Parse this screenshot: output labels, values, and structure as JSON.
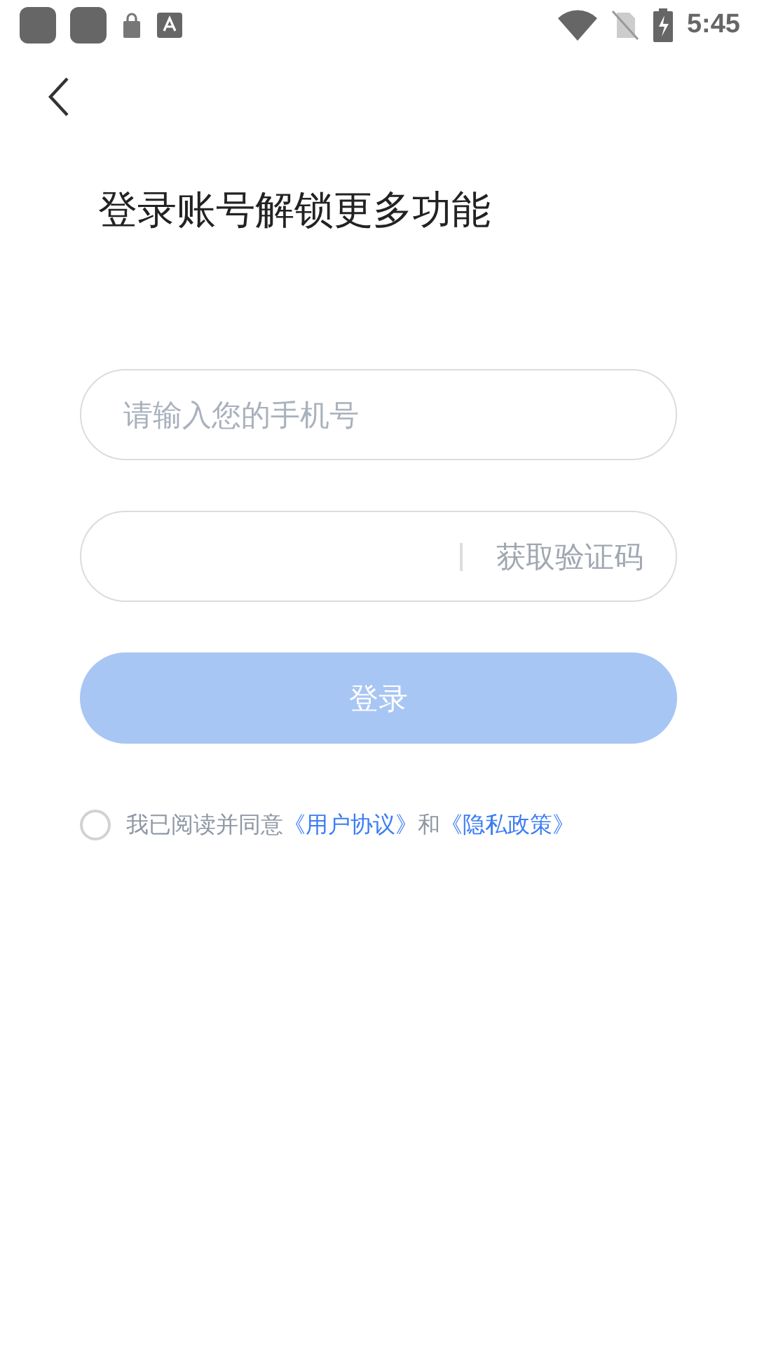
{
  "status_bar": {
    "time": "5:45"
  },
  "title": "登录账号解锁更多功能",
  "phone_field": {
    "placeholder": "请输入您的手机号"
  },
  "code_field": {
    "get_code_button": "获取验证码"
  },
  "login_button": {
    "label": "登录",
    "disabled": true
  },
  "agreement": {
    "checked": false,
    "parts": [
      {
        "kind": "text",
        "text": "我已阅读并同意"
      },
      {
        "kind": "link",
        "text": "《用户协议》"
      },
      {
        "kind": "text",
        "text": "和"
      },
      {
        "kind": "link",
        "text": "《隐私政策》"
      }
    ]
  }
}
